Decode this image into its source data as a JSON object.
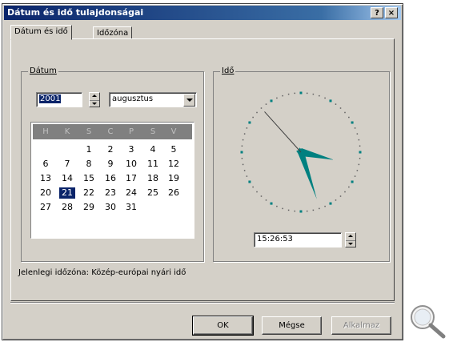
{
  "window": {
    "title": "Dátum és idő tulajdonságai",
    "help_label": "?",
    "close_label": "×"
  },
  "tabs": [
    {
      "label": "Dátum és idő",
      "active": true
    },
    {
      "label": "Időzóna",
      "active": false
    }
  ],
  "date_group": {
    "label": "Dátum",
    "year_value": "2001",
    "month_value": "augusztus",
    "weekday_headers": [
      "H",
      "K",
      "S",
      "C",
      "P",
      "S",
      "V"
    ],
    "weeks": [
      [
        "",
        "",
        "1",
        "2",
        "3",
        "4",
        "5"
      ],
      [
        "6",
        "7",
        "8",
        "9",
        "10",
        "11",
        "12"
      ],
      [
        "13",
        "14",
        "15",
        "16",
        "17",
        "18",
        "19"
      ],
      [
        "20",
        "21",
        "22",
        "23",
        "24",
        "25",
        "26"
      ],
      [
        "27",
        "28",
        "29",
        "30",
        "31",
        "",
        ""
      ]
    ],
    "selected_day": "21"
  },
  "time_group": {
    "label": "Idő",
    "time_value": "15:26:53"
  },
  "timezone_text": "Jelenlegi időzóna: Közép-európai nyári idő",
  "buttons": {
    "ok": "OK",
    "cancel": "Mégse",
    "apply": "Alkalmaz"
  },
  "colors": {
    "titlebar": "#0a246a",
    "clock_hands": "#008080",
    "selection": "#0a246a"
  },
  "icons": {
    "zoom": "magnifier-icon"
  }
}
